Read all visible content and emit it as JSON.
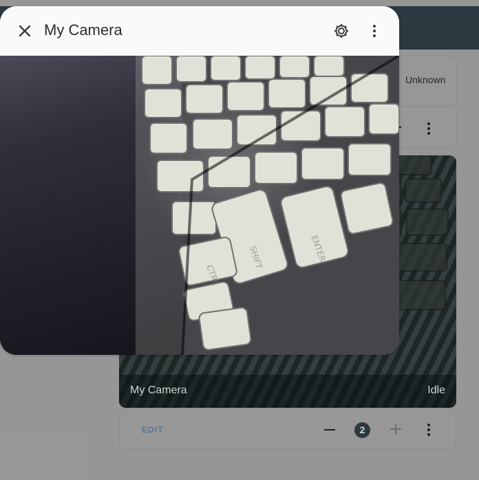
{
  "dialog": {
    "title": "My Camera",
    "close_icon": "close-icon",
    "settings_icon": "gear-icon",
    "menu_icon": "vertical-dots-icon"
  },
  "cards": {
    "top_status": "Unknown",
    "camera_name": "My Camera",
    "camera_state": "Idle",
    "edit_label": "EDIT",
    "count": "2"
  },
  "colors": {
    "header": "#2d3b42",
    "overlay": "#9b9b9b",
    "edit": "#4e79a7"
  },
  "icons": {
    "minus": "minus-icon",
    "plus": "plus-icon",
    "card_menu": "vertical-dots-icon"
  }
}
